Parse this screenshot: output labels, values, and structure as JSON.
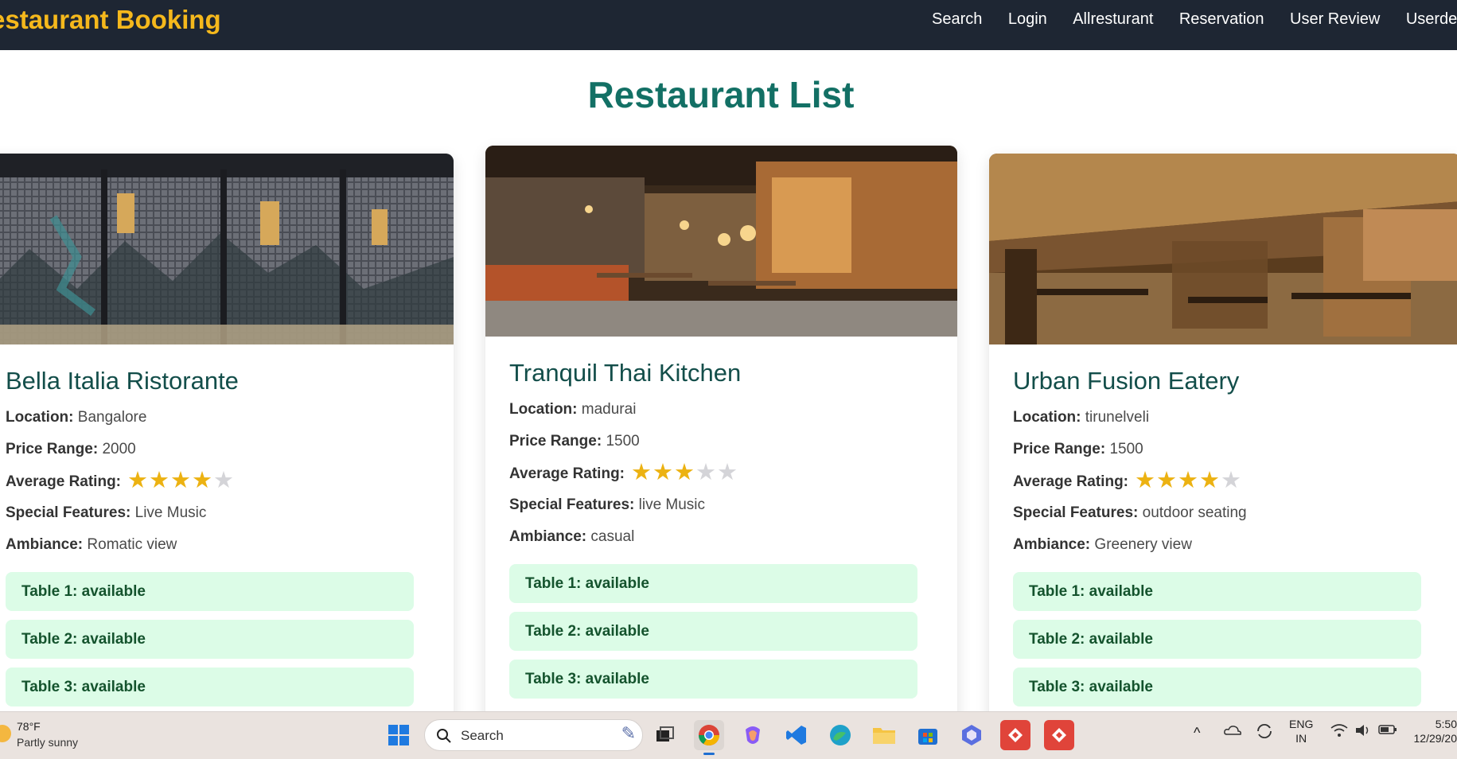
{
  "navbar": {
    "brand": "estaurant Booking",
    "links": [
      "Search",
      "Login",
      "Allresturant",
      "Reservation",
      "User Review",
      "Userdetails"
    ]
  },
  "page_title": "Restaurant List",
  "labels": {
    "location": "Location:",
    "price": "Price Range:",
    "rating": "Average Rating:",
    "features": "Special Features:",
    "ambiance": "Ambiance:"
  },
  "restaurants": [
    {
      "name": "Bella Italia Ristorante",
      "location": "Bangalore",
      "price_range": "2000",
      "rating": 4,
      "rating_max": 5,
      "special_features": "Live Music",
      "ambiance": "Romatic view",
      "tables": [
        "Table 1: available",
        "Table 2: available",
        "Table 3: available"
      ]
    },
    {
      "name": "Tranquil Thai Kitchen",
      "location": "madurai",
      "price_range": "1500",
      "rating": 3,
      "rating_max": 5,
      "special_features": "live Music",
      "ambiance": "casual",
      "tables": [
        "Table 1: available",
        "Table 2: available",
        "Table 3: available"
      ]
    },
    {
      "name": "Urban Fusion Eatery",
      "location": "tirunelveli",
      "price_range": "1500",
      "rating": 4,
      "rating_max": 5,
      "special_features": "outdoor seating",
      "ambiance": "Greenery view",
      "tables": [
        "Table 1: available",
        "Table 2: available",
        "Table 3: available"
      ]
    }
  ],
  "taskbar": {
    "weather_temp": "78°F",
    "weather_desc": "Partly sunny",
    "search_label": "Search",
    "lang_top": "ENG",
    "lang_bottom": "IN",
    "time": "5:50",
    "date": "12/29/20",
    "apps": [
      "windows-start-icon",
      "task-view-icon",
      "chrome-icon",
      "copilot-icon",
      "vscode-icon",
      "edge-icon",
      "file-explorer-icon",
      "microsoft-store-icon",
      "m365-icon",
      "anydesk-icon",
      "anydesk-icon"
    ]
  },
  "colors": {
    "navbar_bg": "#1e2633",
    "brand": "#f5b81c",
    "title": "#137065",
    "card_title": "#134e4a",
    "table_bg": "#dcfce7",
    "table_text": "#14532d",
    "star_on": "#ecb212",
    "star_off": "#d4d4d8"
  }
}
